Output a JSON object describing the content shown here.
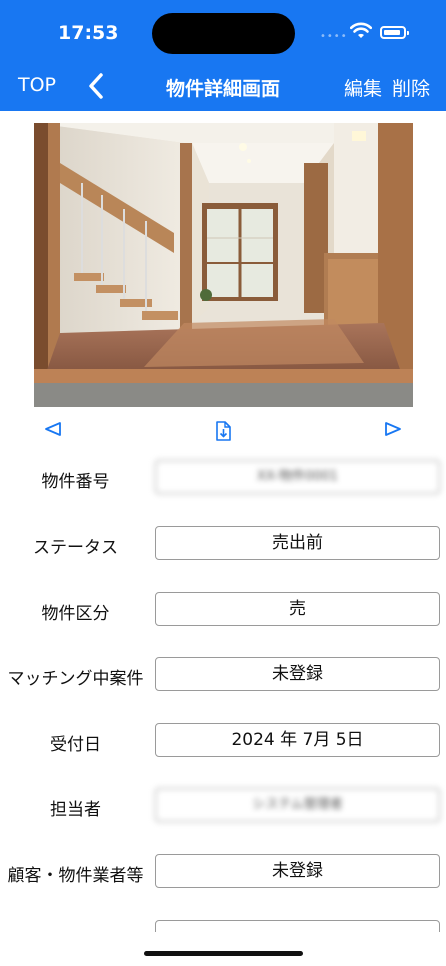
{
  "status_bar": {
    "time": "17:53"
  },
  "nav": {
    "top_label": "TOP",
    "title": "物件詳細画面",
    "edit_label": "編集",
    "delete_label": "削除"
  },
  "colors": {
    "header_bg": "#1877f2",
    "accent": "#1877f2"
  },
  "photo": {
    "icon_prev": "triangle-left-icon",
    "icon_download": "document-download-icon",
    "icon_next": "triangle-right-icon"
  },
  "fields": [
    {
      "label": "物件番号",
      "value": "XX-物件0001",
      "blurred": true
    },
    {
      "label": "ステータス",
      "value": "売出前"
    },
    {
      "label": "物件区分",
      "value": "売"
    },
    {
      "label": "マッチング中案件",
      "value": "未登録"
    },
    {
      "label": "受付日",
      "value": "2024 年 7月 5日"
    },
    {
      "label": "担当者",
      "value": "システム管理者",
      "blurred": true
    },
    {
      "label": "顧客・物件業者等",
      "value": "未登録"
    }
  ]
}
